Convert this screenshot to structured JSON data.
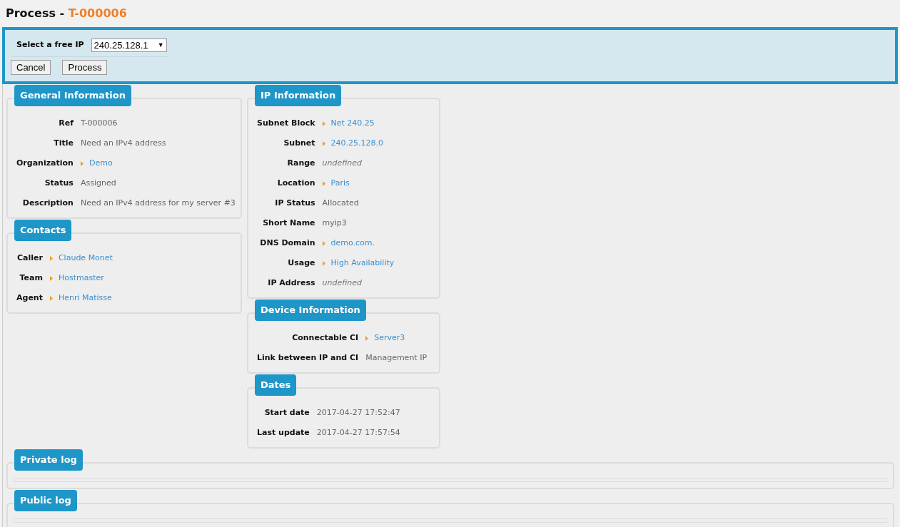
{
  "title": {
    "prefix": "Process - ",
    "ref": "T-000006"
  },
  "form": {
    "label": "Select a free IP",
    "select_value": "240.25.128.1",
    "select_arrow": "▼",
    "buttons": [
      "Cancel",
      "Process"
    ]
  },
  "columns": [
    [
      {
        "title": "General Information",
        "fields": [
          {
            "label": "Ref",
            "value": "T-000006",
            "kind": "text"
          },
          {
            "label": "Title",
            "value": "Need an IPv4 address",
            "kind": "text"
          },
          {
            "label": "Organization",
            "value": "Demo",
            "kind": "link"
          },
          {
            "label": "Status",
            "value": "Assigned",
            "kind": "text"
          },
          {
            "label": "Description",
            "value": "Need an IPv4 address for my server #3",
            "kind": "text"
          }
        ]
      },
      {
        "title": "Contacts",
        "fields": [
          {
            "label": "Caller",
            "value": "Claude Monet",
            "kind": "link"
          },
          {
            "label": "Team",
            "value": "Hostmaster",
            "kind": "link"
          },
          {
            "label": "Agent",
            "value": "Henri Matisse",
            "kind": "link"
          }
        ]
      }
    ],
    [
      {
        "title": "IP Information",
        "fields": [
          {
            "label": "Subnet Block",
            "value": "Net 240.25",
            "kind": "link"
          },
          {
            "label": "Subnet",
            "value": "240.25.128.0",
            "kind": "link"
          },
          {
            "label": "Range",
            "value": "undefined",
            "kind": "undefined"
          },
          {
            "label": "Location",
            "value": "Paris",
            "kind": "link"
          },
          {
            "label": "IP Status",
            "value": "Allocated",
            "kind": "text"
          },
          {
            "label": "Short Name",
            "value": "myip3",
            "kind": "text"
          },
          {
            "label": "DNS Domain",
            "value": "demo.com.",
            "kind": "link"
          },
          {
            "label": "Usage",
            "value": "High Availability",
            "kind": "link"
          },
          {
            "label": "IP Address",
            "value": "undefined",
            "kind": "undefined"
          }
        ]
      },
      {
        "title": "Device Information",
        "fields": [
          {
            "label": "Connectable CI",
            "value": "Server3",
            "kind": "link"
          },
          {
            "label": "Link between IP and CI",
            "value": "Management IP",
            "kind": "text"
          }
        ]
      },
      {
        "title": "Dates",
        "fields": [
          {
            "label": "Start date",
            "value": "2017-04-27 17:52:47",
            "kind": "text"
          },
          {
            "label": "Last update",
            "value": "2017-04-27 17:57:54",
            "kind": "text"
          }
        ]
      }
    ]
  ],
  "logs": [
    {
      "title": "Private log"
    },
    {
      "title": "Public log"
    }
  ]
}
